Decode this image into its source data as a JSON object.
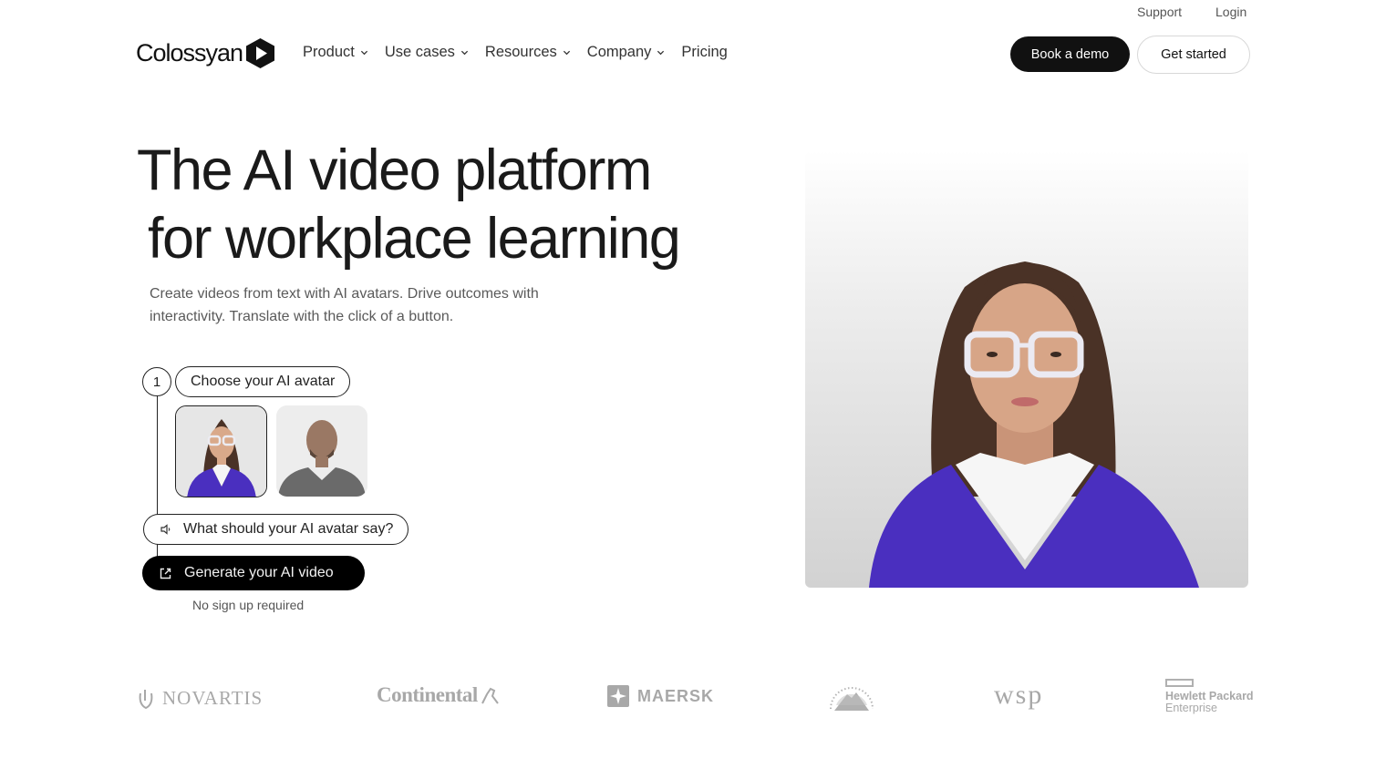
{
  "utility_nav": {
    "support": "Support",
    "login": "Login"
  },
  "header": {
    "brand": "Colossyan",
    "nav": [
      {
        "label": "Product",
        "has_dropdown": true
      },
      {
        "label": "Use cases",
        "has_dropdown": true
      },
      {
        "label": "Resources",
        "has_dropdown": true
      },
      {
        "label": "Company",
        "has_dropdown": true
      },
      {
        "label": "Pricing",
        "has_dropdown": false
      }
    ],
    "book_demo": "Book a demo",
    "get_started": "Get started"
  },
  "hero": {
    "title_line1": "The AI video platform",
    "title_line2": "for workplace learning",
    "subtitle": "Create videos from text with AI avatars. Drive outcomes with interactivity. Translate with the click of a button.",
    "step_number": "1",
    "choose_avatar": "Choose your AI avatar",
    "avatars": [
      {
        "name": "female-avatar",
        "selected": true,
        "sweater_color": "#4a2fbf"
      },
      {
        "name": "male-avatar",
        "selected": false,
        "shirt_color": "#6a6a6a"
      }
    ],
    "say_prompt": "What should your AI avatar say?",
    "generate_button": "Generate your AI video",
    "no_signup": "No sign up required",
    "preview_avatar": {
      "sweater_color": "#4a2fbf",
      "hair_color": "#4a3226"
    }
  },
  "logos": {
    "novartis": "NOVARTIS",
    "continental": "Continental",
    "maersk": "MAERSK",
    "paramount": "Paramount",
    "wsp": "wsp",
    "hpe_line1": "Hewlett Packard",
    "hpe_line2": "Enterprise"
  },
  "colors": {
    "primary_dark": "#111111",
    "accent_purple": "#4a2fbf",
    "logo_gray": "#a8a8a8"
  }
}
